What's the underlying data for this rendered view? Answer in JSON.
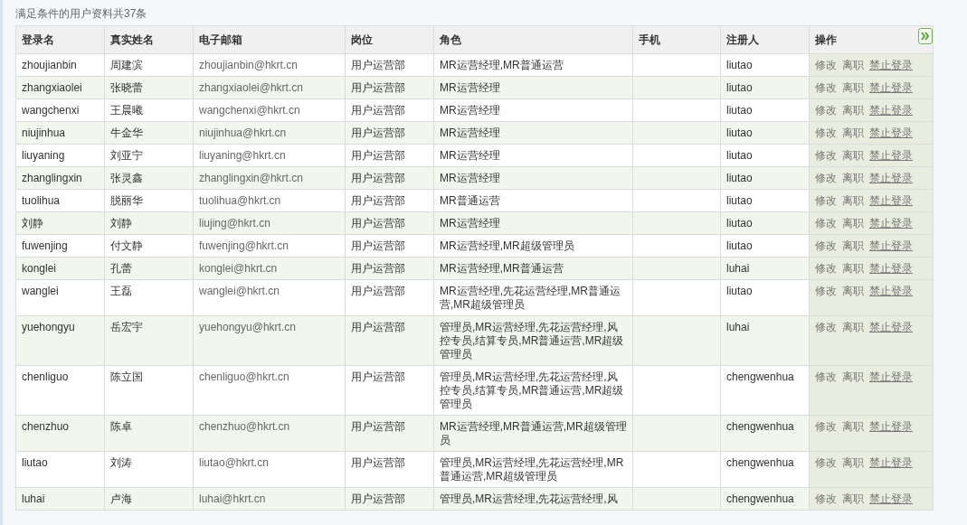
{
  "summary": "满足条件的用户资料共37条",
  "table": {
    "columns": [
      "登录名",
      "真实姓名",
      "电子邮箱",
      "岗位",
      "角色",
      "手机",
      "注册人",
      "操作"
    ],
    "rows": [
      {
        "login": "zhoujianbin",
        "name": "周建滨",
        "email": "zhoujianbin@hkrt.cn",
        "post": "用户运营部",
        "roles": "MR运营经理,MR普通运营",
        "registrar": "liutao",
        "actions": [
          {
            "label": "修改",
            "underlined": false
          },
          {
            "label": "离职",
            "underlined": false
          },
          {
            "label": "禁止登录",
            "underlined": true
          }
        ]
      },
      {
        "login": "zhangxiaolei",
        "name": "张晓蕾",
        "email": "zhangxiaolei@hkrt.cn",
        "post": "用户运营部",
        "roles": "MR运营经理",
        "registrar": "liutao",
        "actions": [
          {
            "label": "修改",
            "underlined": false
          },
          {
            "label": "离职",
            "underlined": false
          },
          {
            "label": "禁止登录",
            "underlined": true
          }
        ]
      },
      {
        "login": "wangchenxi",
        "name": "王晨曦",
        "email": "wangchenxi@hkrt.cn",
        "post": "用户运营部",
        "roles": "MR运营经理",
        "registrar": "liutao",
        "actions": [
          {
            "label": "修改",
            "underlined": false
          },
          {
            "label": "离职",
            "underlined": false
          },
          {
            "label": "禁止登录",
            "underlined": true
          }
        ]
      },
      {
        "login": "niujinhua",
        "name": "牛金华",
        "email": "niujinhua@hkrt.cn",
        "post": "用户运营部",
        "roles": "MR运营经理",
        "registrar": "liutao",
        "actions": [
          {
            "label": "修改",
            "underlined": false
          },
          {
            "label": "离职",
            "underlined": false
          },
          {
            "label": "禁止登录",
            "underlined": true
          }
        ]
      },
      {
        "login": "liuyaning",
        "name": "刘亚宁",
        "email": "liuyaning@hkrt.cn",
        "post": "用户运营部",
        "roles": "MR运营经理",
        "registrar": "liutao",
        "actions": [
          {
            "label": "修改",
            "underlined": false
          },
          {
            "label": "离职",
            "underlined": false
          },
          {
            "label": "禁止登录",
            "underlined": true
          }
        ]
      },
      {
        "login": "zhanglingxin",
        "name": "张灵鑫",
        "email": "zhanglingxin@hkrt.cn",
        "post": "用户运营部",
        "roles": "MR运营经理",
        "registrar": "liutao",
        "actions": [
          {
            "label": "修改",
            "underlined": false
          },
          {
            "label": "离职",
            "underlined": false
          },
          {
            "label": "禁止登录",
            "underlined": true
          }
        ]
      },
      {
        "login": "tuolihua",
        "name": "脱丽华",
        "email": "tuolihua@hkrt.cn",
        "post": "用户运营部",
        "roles": "MR普通运营",
        "registrar": "liutao",
        "actions": [
          {
            "label": "修改",
            "underlined": false
          },
          {
            "label": "离职",
            "underlined": false
          },
          {
            "label": "禁止登录",
            "underlined": true
          }
        ]
      },
      {
        "login": "刘静",
        "name": "刘静",
        "email": "liujing@hkrt.cn",
        "post": "用户运营部",
        "roles": "MR运营经理",
        "registrar": "liutao",
        "actions": [
          {
            "label": "修改",
            "underlined": false
          },
          {
            "label": "离职",
            "underlined": false
          },
          {
            "label": "禁止登录",
            "underlined": true
          }
        ]
      },
      {
        "login": "fuwenjing",
        "name": "付文静",
        "email": "fuwenjing@hkrt.cn",
        "post": "用户运营部",
        "roles": "MR运营经理,MR超级管理员",
        "registrar": "liutao",
        "actions": [
          {
            "label": "修改",
            "underlined": false
          },
          {
            "label": "离职",
            "underlined": false
          },
          {
            "label": "禁止登录",
            "underlined": true
          }
        ]
      },
      {
        "login": "konglei",
        "name": "孔蕾",
        "email": "konglei@hkrt.cn",
        "post": "用户运营部",
        "roles": "MR运营经理,MR普通运营",
        "registrar": "luhai",
        "actions": [
          {
            "label": "修改",
            "underlined": false
          },
          {
            "label": "离职",
            "underlined": false
          },
          {
            "label": "禁止登录",
            "underlined": true
          }
        ]
      },
      {
        "login": "wanglei",
        "name": "王磊",
        "email": "wanglei@hkrt.cn",
        "post": "用户运营部",
        "roles": "MR运营经理,先花运营经理,MR普通运营,MR超级管理员",
        "registrar": "liutao",
        "actions": [
          {
            "label": "修改",
            "underlined": false
          },
          {
            "label": "离职",
            "underlined": false
          },
          {
            "label": "禁止登录",
            "underlined": true
          }
        ]
      },
      {
        "login": "yuehongyu",
        "name": "岳宏宇",
        "email": "yuehongyu@hkrt.cn",
        "post": "用户运营部",
        "roles": "管理员,MR运营经理,先花运营经理,风控专员,结算专员,MR普通运营,MR超级管理员",
        "registrar": "luhai",
        "actions": [
          {
            "label": "修改",
            "underlined": false
          },
          {
            "label": "离职",
            "underlined": false
          },
          {
            "label": "禁止登录",
            "underlined": true
          }
        ]
      },
      {
        "login": "chenliguo",
        "name": "陈立国",
        "email": "chenliguo@hkrt.cn",
        "post": "用户运营部",
        "roles": "管理员,MR运营经理,先花运营经理,风控专员,结算专员,MR普通运营,MR超级管理员",
        "registrar": "chengwenhua",
        "actions": [
          {
            "label": "修改",
            "underlined": false
          },
          {
            "label": "离职",
            "underlined": false
          },
          {
            "label": "禁止登录",
            "underlined": true
          }
        ]
      },
      {
        "login": "chenzhuo",
        "name": "陈卓",
        "email": "chenzhuo@hkrt.cn",
        "post": "用户运营部",
        "roles": "MR运营经理,MR普通运营,MR超级管理员",
        "registrar": "chengwenhua",
        "actions": [
          {
            "label": "修改",
            "underlined": false
          },
          {
            "label": "离职",
            "underlined": false
          },
          {
            "label": "禁止登录",
            "underlined": true
          }
        ]
      },
      {
        "login": "liutao",
        "name": "刘涛",
        "email": "liutao@hkrt.cn",
        "post": "用户运营部",
        "roles": "管理员,MR运营经理,先花运营经理,MR普通运营,MR超级管理员",
        "registrar": "chengwenhua",
        "actions": [
          {
            "label": "修改",
            "underlined": false
          },
          {
            "label": "离职",
            "underlined": false
          },
          {
            "label": "禁止登录",
            "underlined": true
          }
        ]
      },
      {
        "login": "luhai",
        "name": "卢海",
        "email": "luhai@hkrt.cn",
        "post": "用户运营部",
        "roles": "管理员,MR运营经理,先花运营经理,风",
        "registrar": "chengwenhua",
        "actions": [
          {
            "label": "修改",
            "underlined": false
          },
          {
            "label": "离职",
            "underlined": false
          },
          {
            "label": "禁止登录",
            "underlined": true
          }
        ]
      }
    ]
  }
}
